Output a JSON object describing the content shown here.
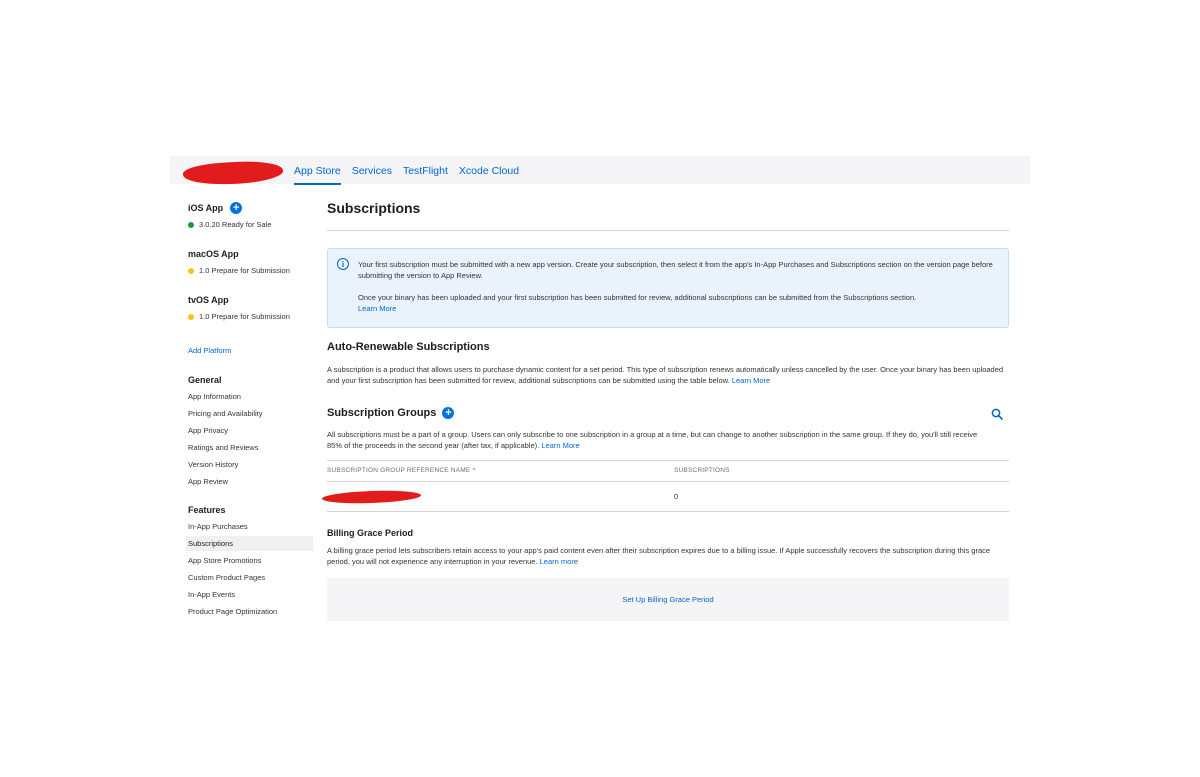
{
  "topnav": {
    "tabs": [
      {
        "label": "App Store",
        "active": true
      },
      {
        "label": "Services",
        "active": false
      },
      {
        "label": "TestFlight",
        "active": false
      },
      {
        "label": "Xcode Cloud",
        "active": false
      }
    ]
  },
  "sidebar": {
    "platforms": [
      {
        "name": "iOS App",
        "status": "3.0.20 Ready for Sale",
        "status_color": "#1a9c3b"
      },
      {
        "name": "macOS App",
        "status": "1.0 Prepare for Submission",
        "status_color": "#f5c518"
      },
      {
        "name": "tvOS App",
        "status": "1.0 Prepare for Submission",
        "status_color": "#f5c518"
      }
    ],
    "add_platform": "Add Platform",
    "general": {
      "title": "General",
      "items": [
        "App Information",
        "Pricing and Availability",
        "App Privacy",
        "Ratings and Reviews",
        "Version History",
        "App Review"
      ]
    },
    "features": {
      "title": "Features",
      "items": [
        "In-App Purchases",
        "Subscriptions",
        "App Store Promotions",
        "Custom Product Pages",
        "In-App Events",
        "Product Page Optimization"
      ],
      "selected": "Subscriptions"
    }
  },
  "main": {
    "title": "Subscriptions",
    "info": {
      "line1": "Your first subscription must be submitted with a new app version. Create your subscription, then select it from the app's In-App Purchases and Subscriptions section on the version page before submitting the version to App Review.",
      "line2": "Once your binary has been uploaded and your first subscription has been submitted for review, additional subscriptions can be submitted from the Subscriptions section.",
      "link": "Learn More"
    },
    "auto_renewable": {
      "title": "Auto-Renewable Subscriptions",
      "text": "A subscription is a product that allows users to purchase dynamic content for a set period. This type of subscription renews automatically unless cancelled by the user. Once your binary has been uploaded and your first subscription has been submitted for review, additional subscriptions can be submitted using the table below.",
      "link": "Learn More"
    },
    "groups": {
      "title": "Subscription Groups",
      "text": "All subscriptions must be a part of a group. Users can only subscribe to one subscription in a group at a time, but can change to another subscription in the same group. If they do, you'll still receive 85% of the proceeds in the second year (after tax, if applicable).",
      "link": "Learn More",
      "columns": [
        "SUBSCRIPTION GROUP REFERENCE NAME ^",
        "SUBSCRIPTIONS"
      ],
      "rows": [
        {
          "name": "",
          "subscriptions": "0"
        }
      ]
    },
    "billing": {
      "title": "Billing Grace Period",
      "text": "A billing grace period lets subscribers retain access to your app's paid content even after their subscription expires due to a billing issue. If Apple successfully recovers the subscription during this grace period, you will not experience any interruption in your revenue.",
      "link": "Learn more",
      "button": "Set Up Billing Grace Period"
    }
  },
  "colors": {
    "accent": "#0066cc",
    "redaction": "#e21c1c",
    "info_bg": "#eaf3fb"
  }
}
